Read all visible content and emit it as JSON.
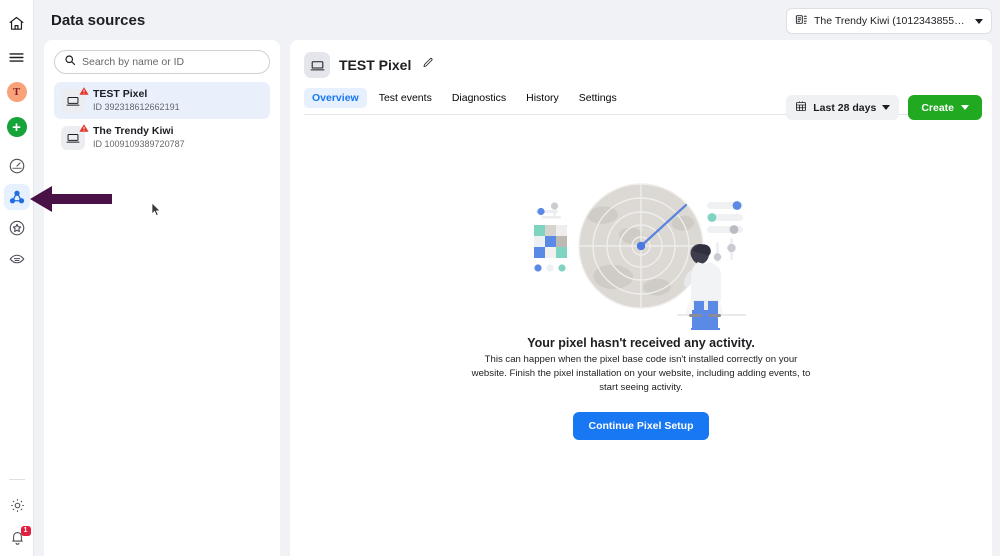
{
  "page": {
    "title": "Data sources"
  },
  "account": {
    "icon": "business-account-icon",
    "name": "The Trendy Kiwi (101234385587…",
    "chevron": "chevron-down-icon"
  },
  "rail": {
    "items": [
      {
        "name": "home-icon",
        "label": "Home"
      },
      {
        "name": "menu-icon",
        "label": "Menu"
      },
      {
        "name": "avatar",
        "label": "T"
      },
      {
        "name": "add-icon",
        "label": "+"
      },
      {
        "name": "gauge-icon",
        "label": "Performance"
      },
      {
        "name": "data-sources-icon",
        "label": "Data sources"
      },
      {
        "name": "star-badge-icon",
        "label": "Rewards"
      },
      {
        "name": "brand-safety-icon",
        "label": "Brand safety"
      }
    ],
    "bottom": [
      {
        "name": "gear-icon",
        "label": "Settings"
      },
      {
        "name": "bell-icon",
        "label": "Notifications",
        "badge": "1"
      }
    ]
  },
  "search": {
    "placeholder": "Search by name or ID",
    "value": "",
    "icon": "search-icon"
  },
  "data_sources": [
    {
      "name": "TEST Pixel",
      "id_label": "ID 392318612662191",
      "icon": "pixel-icon",
      "warning": "warning-triangle-icon",
      "selected": true
    },
    {
      "name": "The Trendy Kiwi",
      "id_label": "ID 1009109389720787",
      "icon": "pixel-icon",
      "warning": "warning-triangle-icon",
      "selected": false
    }
  ],
  "detail": {
    "icon": "pixel-icon",
    "title": "TEST Pixel",
    "edit_icon": "pencil-icon",
    "tabs": [
      {
        "label": "Overview",
        "active": true
      },
      {
        "label": "Test events",
        "active": false
      },
      {
        "label": "Diagnostics",
        "active": false
      },
      {
        "label": "History",
        "active": false
      },
      {
        "label": "Settings",
        "active": false
      }
    ],
    "date_range": {
      "label": "Last 28 days",
      "icon": "calendar-icon",
      "chevron": "chevron-down-icon"
    },
    "create": {
      "label": "Create",
      "chevron": "chevron-down-icon"
    }
  },
  "empty_state": {
    "illustration": "radar-person-illustration",
    "title": "Your pixel hasn't received any activity.",
    "body": "This can happen when the pixel base code isn't installed correctly on your website. Finish the pixel installation on your website, including adding events, to start seeing activity.",
    "cta_label": "Continue Pixel Setup"
  },
  "annotation": {
    "arrow": "left-pointing-arrow-annotation",
    "cursor": "mouse-cursor"
  },
  "colors": {
    "accent_blue": "#1877f2",
    "create_green": "#22a922",
    "warning_red": "#e41e3f",
    "annotation_purple": "#4a1146",
    "avatar_orange": "#f7a278"
  }
}
